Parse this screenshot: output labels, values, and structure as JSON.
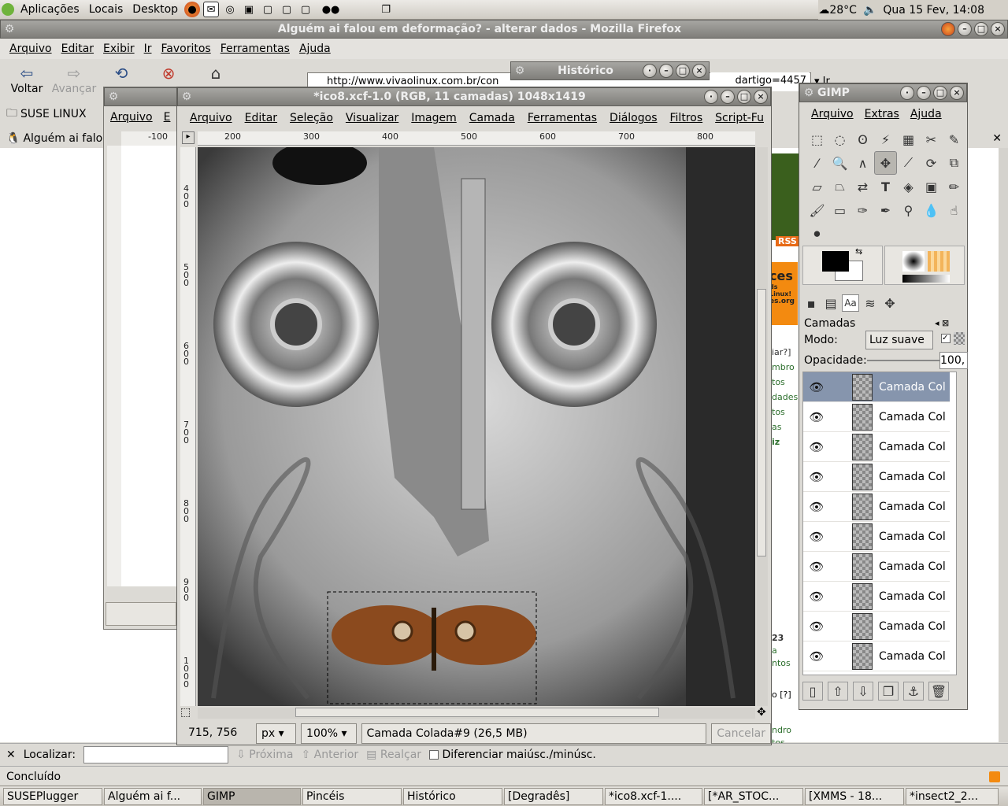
{
  "top_panel": {
    "menus": [
      "Aplicações",
      "Locais",
      "Desktop"
    ],
    "weather": "28°C",
    "clock": "Qua 15 Fev, 14:08"
  },
  "firefox": {
    "title": "Alguém ai falou em deformação? - alterar dados - Mozilla Firefox",
    "menu": [
      "Arquivo",
      "Editar",
      "Exibir",
      "Ir",
      "Favoritos",
      "Ferramentas",
      "Ajuda"
    ],
    "nav": {
      "back": "Voltar",
      "forward": "Avançar"
    },
    "url": "http://www.vivaolinux.com.br/con",
    "url_tail": "dartigo=4457",
    "go_label": "Ir",
    "bookmark": "SUSE LINUX",
    "tab": "Alguém ai falou",
    "find": {
      "label": "Localizar:",
      "next": "Próxima",
      "prev": "Anterior",
      "highlight": "Realçar",
      "match_case": "Diferenciar maiúsc./minúsc."
    },
    "status": "Concluído",
    "page_fragments": [
      "RSS",
      "mbro",
      "tos",
      "dades",
      "tos",
      "as",
      "iz",
      "iar?]",
      "23",
      "a",
      "ntos",
      "o [?]",
      "ndro",
      "tos",
      "ces",
      "ds Linux!",
      "es.org"
    ]
  },
  "history_window": {
    "title": "Histórico"
  },
  "bg_window": {
    "menu": [
      "Arquivo",
      "E"
    ],
    "ruler_label": "-100"
  },
  "image_window": {
    "title": "*ico8.xcf-1.0 (RGB, 11 camadas) 1048x1419",
    "menu": [
      "Arquivo",
      "Editar",
      "Seleção",
      "Visualizar",
      "Imagem",
      "Camada",
      "Ferramentas",
      "Diálogos",
      "Filtros",
      "Script-Fu"
    ],
    "h_ruler": [
      "200",
      "300",
      "400",
      "500",
      "600",
      "700",
      "800"
    ],
    "v_ruler": [
      "400",
      "500",
      "600",
      "700",
      "800",
      "900",
      "1000"
    ],
    "coords": "715, 756",
    "unit": "px",
    "zoom": "100%",
    "layer_info": "Camada Colada#9 (26,5 MB)",
    "cancel": "Cancelar"
  },
  "toolbox": {
    "title": "GIMP",
    "menu": [
      "Arquivo",
      "Extras",
      "Ajuda"
    ],
    "layers_title": "Camadas",
    "mode_label": "Modo:",
    "mode_value": "Luz suave",
    "opacity_label": "Opacidade:",
    "opacity_value": "100,",
    "layers": [
      "Camada Col",
      "Camada Col",
      "Camada Col",
      "Camada Col",
      "Camada Col",
      "Camada Col",
      "Camada Col",
      "Camada Col",
      "Camada Col",
      "Camada Col"
    ]
  },
  "taskbar": [
    "SUSEPlugger",
    "Alguém ai f...",
    "GIMP",
    "Pincéis",
    "Histórico",
    "[Degradês]",
    "*ico8.xcf-1....",
    "[*AR_STOC...",
    "[XMMS - 18...",
    "*insect2_2..."
  ],
  "colors": {
    "titlebar": "#8f8e8a",
    "selected_layer": "#8695ad",
    "page_bg": "#dcdad5"
  }
}
